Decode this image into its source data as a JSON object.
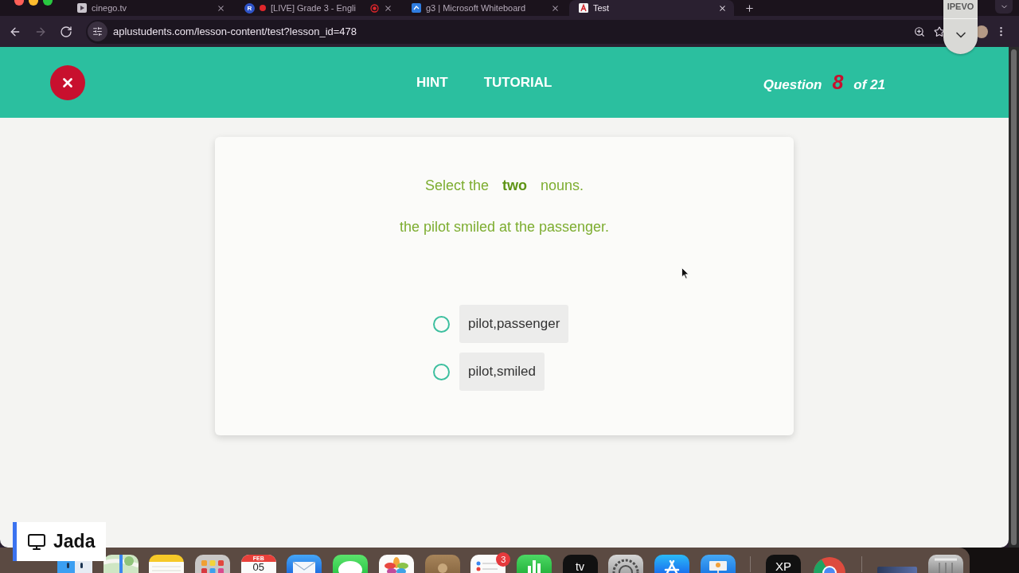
{
  "browser": {
    "tabs": [
      {
        "kind": "play",
        "title": "cinego.tv",
        "recording": false,
        "selected": false
      },
      {
        "kind": "letter",
        "letter": "R",
        "title": "[LIVE] Grade 3 - Engli",
        "recording": true,
        "selected": false
      },
      {
        "kind": "board",
        "title": "g3 | Microsoft Whiteboard",
        "recording": false,
        "selected": false
      },
      {
        "kind": "page",
        "title": "Test",
        "recording": false,
        "selected": true
      }
    ],
    "nav": [
      {
        "kind": "back",
        "disabled": false
      },
      {
        "kind": "forward",
        "disabled": true
      },
      {
        "kind": "reload",
        "disabled": false
      }
    ],
    "url": "aplustudents.com/lesson-content/test?lesson_id=478"
  },
  "overlay": {
    "label": "IPEVO"
  },
  "header": {
    "links": [
      "HINT",
      "TUTORIAL"
    ],
    "progress": {
      "label": "Question",
      "current": "8",
      "total": "of 21"
    }
  },
  "question": {
    "instruction": "Select the **two** nouns.",
    "sentence": "the pilot smiled at the passenger.",
    "options": [
      {
        "label": "pilot,passenger",
        "selected": false
      },
      {
        "label": "pilot,smiled",
        "selected": false
      }
    ]
  },
  "presenter": {
    "name": "Jada"
  },
  "dock": {
    "items": [
      {
        "kind": "finder"
      },
      {
        "kind": "maps"
      },
      {
        "kind": "notes"
      },
      {
        "kind": "launchpad"
      },
      {
        "kind": "calendar",
        "month": "FEB",
        "day": "05"
      },
      {
        "kind": "mail"
      },
      {
        "kind": "messages"
      },
      {
        "kind": "photos"
      },
      {
        "kind": "contacts"
      },
      {
        "kind": "reminders",
        "badge": "3"
      },
      {
        "kind": "numbers"
      },
      {
        "kind": "tv",
        "label": "tv"
      },
      {
        "kind": "settings"
      },
      {
        "kind": "appstore"
      },
      {
        "kind": "keynote"
      },
      {
        "kind": "separator"
      },
      {
        "kind": "xp",
        "label": "XP"
      },
      {
        "kind": "chrome"
      },
      {
        "kind": "separator"
      },
      {
        "kind": "window"
      },
      {
        "kind": "trash"
      }
    ]
  }
}
